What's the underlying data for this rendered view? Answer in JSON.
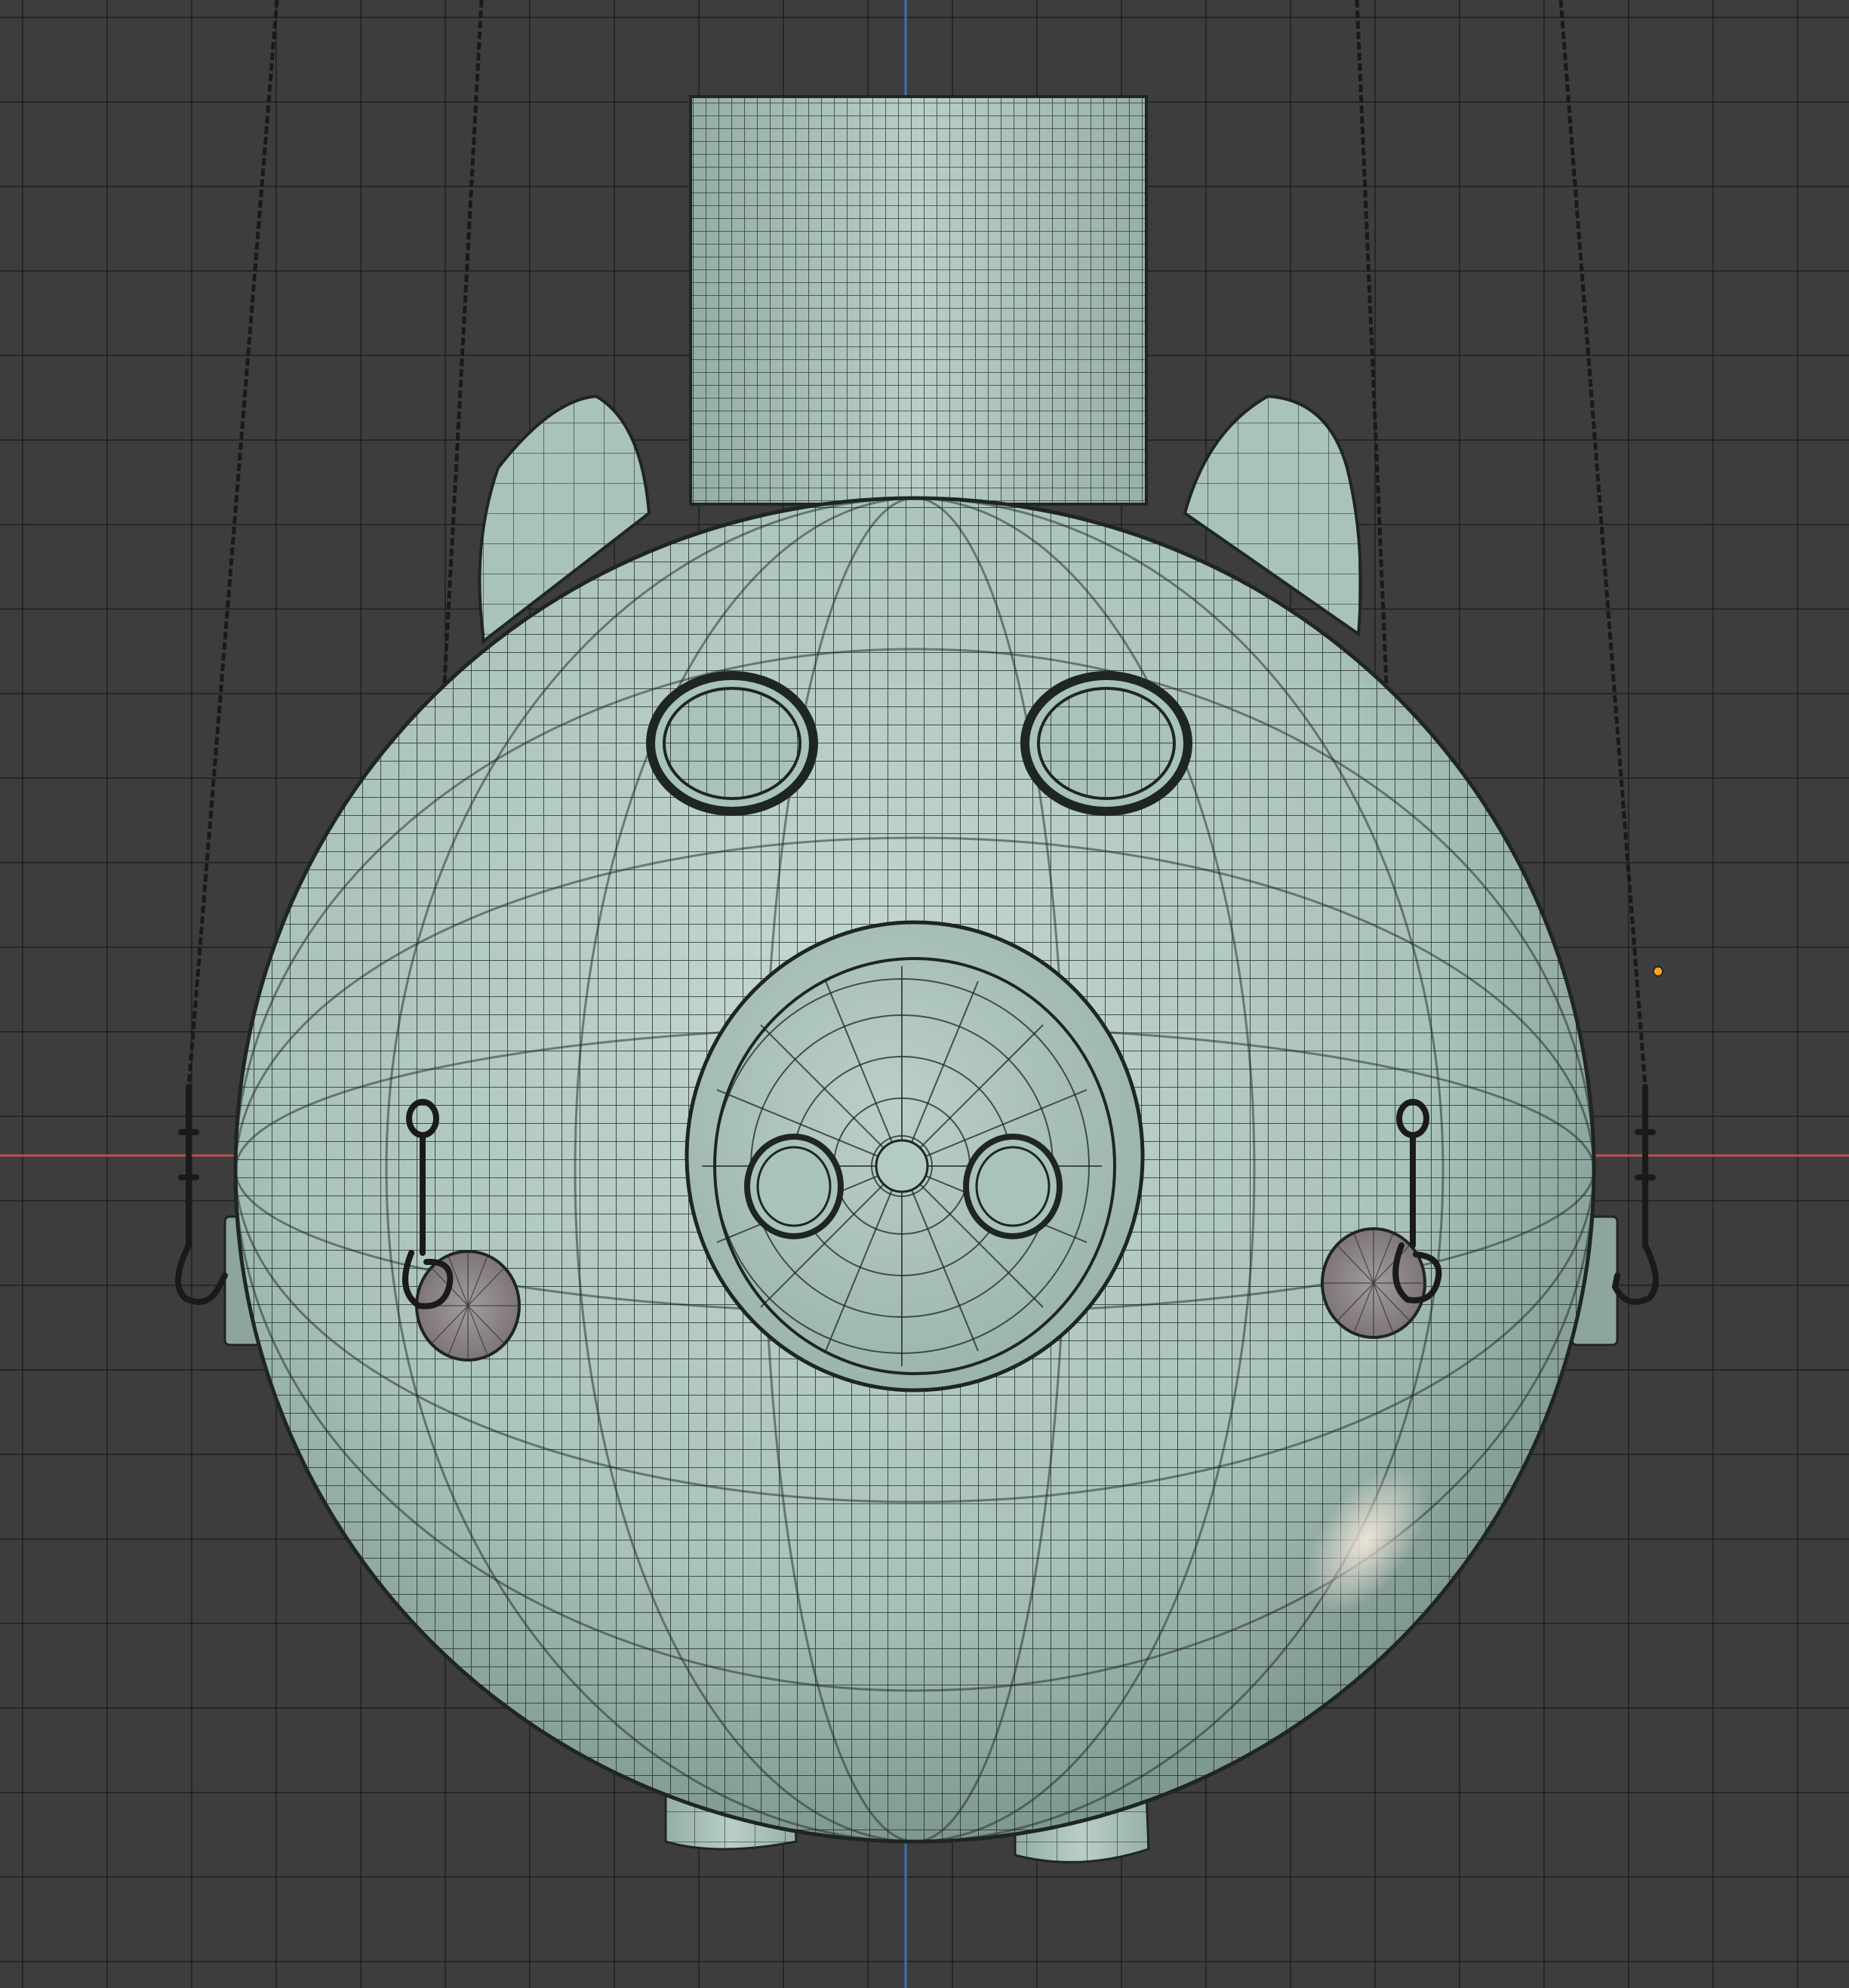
{
  "viewport": {
    "background_color": "#3d3d3d",
    "grid_color": "#262626",
    "x_axis_color": "#c0504d",
    "z_axis_color": "#3f6fb6",
    "origin_marker_color": "#f5a623"
  },
  "model": {
    "shading_mode": "solid-with-wireframe",
    "base_color": "#a9c2bb",
    "wire_color": "#1e2524",
    "speaker_color": "#8c8484"
  }
}
